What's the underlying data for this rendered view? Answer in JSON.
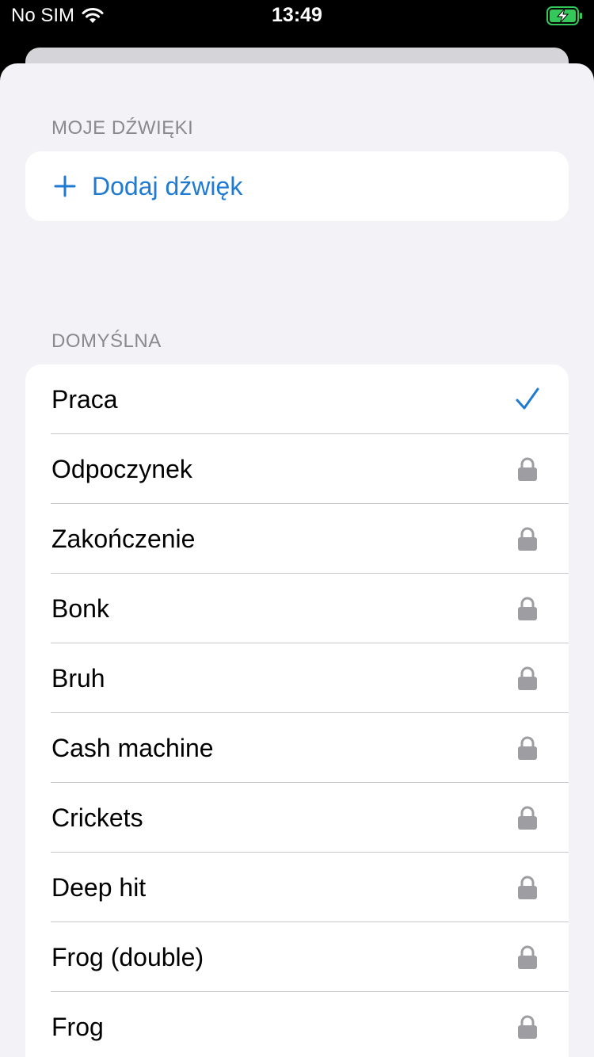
{
  "status_bar": {
    "carrier": "No SIM",
    "time": "13:49"
  },
  "colors": {
    "accent": "#1f7ad1",
    "lock": "#9d9da2",
    "battery": "#34c759"
  },
  "my_sounds": {
    "header": "MOJE DŹWIĘKI",
    "add_label": "Dodaj dźwięk"
  },
  "default_section": {
    "header": "DOMYŚLNA",
    "items": [
      {
        "label": "Praca",
        "state": "selected",
        "icon": "checkmark-icon"
      },
      {
        "label": "Odpoczynek",
        "state": "locked",
        "icon": "lock-icon"
      },
      {
        "label": "Zakończenie",
        "state": "locked",
        "icon": "lock-icon"
      },
      {
        "label": "Bonk",
        "state": "locked",
        "icon": "lock-icon"
      },
      {
        "label": "Bruh",
        "state": "locked",
        "icon": "lock-icon"
      },
      {
        "label": "Cash machine",
        "state": "locked",
        "icon": "lock-icon"
      },
      {
        "label": "Crickets",
        "state": "locked",
        "icon": "lock-icon"
      },
      {
        "label": "Deep hit",
        "state": "locked",
        "icon": "lock-icon"
      },
      {
        "label": "Frog (double)",
        "state": "locked",
        "icon": "lock-icon"
      },
      {
        "label": "Frog",
        "state": "locked",
        "icon": "lock-icon"
      }
    ]
  }
}
